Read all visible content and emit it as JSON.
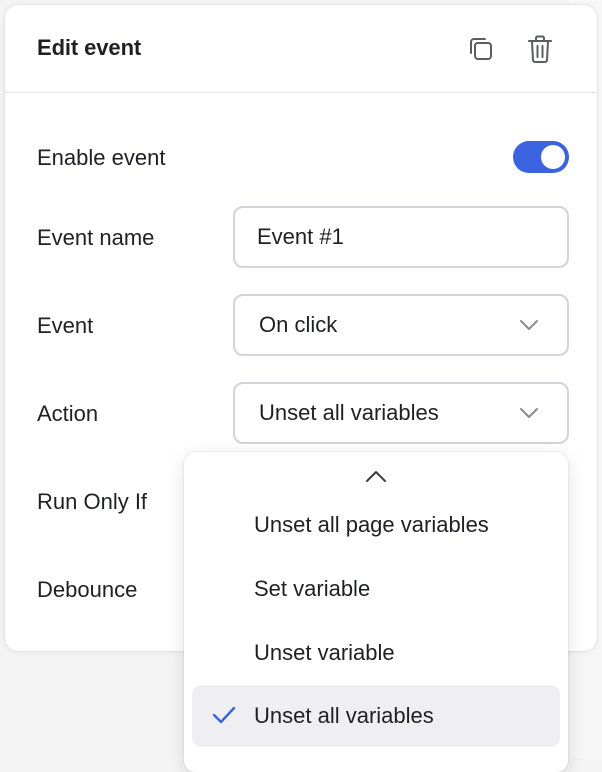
{
  "panel": {
    "title": "Edit event",
    "header_icons": [
      "duplicate-icon",
      "trash-icon"
    ]
  },
  "form": {
    "enable_event": {
      "label": "Enable event",
      "enabled": true
    },
    "event_name": {
      "label": "Event name",
      "value": "Event #1"
    },
    "event": {
      "label": "Event",
      "value": "On click"
    },
    "action": {
      "label": "Action",
      "value": "Unset all variables"
    },
    "run_only_if": {
      "label": "Run Only If"
    },
    "debounce": {
      "label": "Debounce"
    }
  },
  "dropdown": {
    "options": [
      {
        "label": "Unset all page variables",
        "selected": false
      },
      {
        "label": "Set variable",
        "selected": false
      },
      {
        "label": "Unset variable",
        "selected": false
      },
      {
        "label": "Unset all variables",
        "selected": true
      }
    ]
  },
  "colors": {
    "accent": "#3b63e0",
    "selected_bg": "#efeff1",
    "border": "#d4d4d8",
    "text": "#1f2023"
  }
}
